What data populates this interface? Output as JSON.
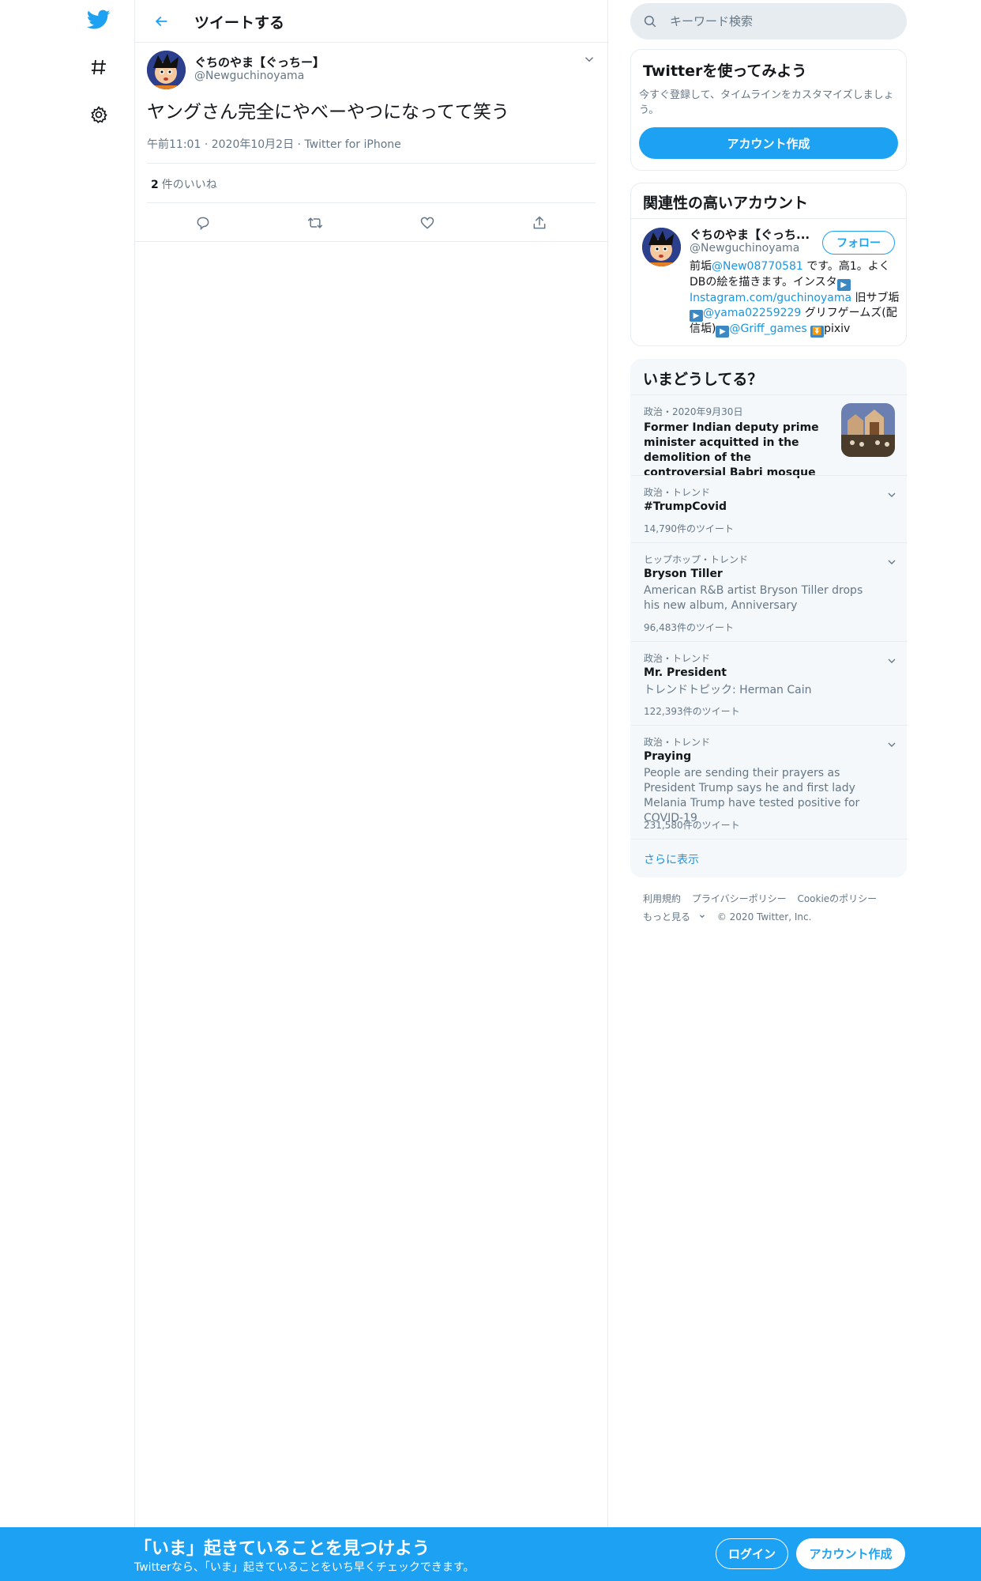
{
  "nav": {
    "logo_icon": "twitter-bird-icon",
    "explore_icon": "hashtag-icon",
    "settings_icon": "gear-icon"
  },
  "header": {
    "back_icon": "arrow-left-icon",
    "title": "ツイートする"
  },
  "tweet": {
    "author_name": "ぐちのやま【ぐっちー】",
    "author_handle": "@Newguchinoyama",
    "text": "ヤングさん完全にやべーやつになってて笑う",
    "time": "午前11:01",
    "date": "2020年10月2日",
    "source": "Twitter for iPhone",
    "likes_count": "2",
    "likes_label": "件のいいね"
  },
  "search": {
    "placeholder": "キーワード検索"
  },
  "signup_card": {
    "title": "Twitterを使ってみよう",
    "subtitle": "今すぐ登録して、タイムラインをカスタマイズしましょう。",
    "button": "アカウント作成"
  },
  "related": {
    "title": "関連性の高いアカウント",
    "name": "ぐちのやま【ぐっち...",
    "handle": "@Newguchinoyama",
    "follow": "フォロー",
    "bio_1": "前垢",
    "bio_link_1": "@New08770581",
    "bio_2": " です。高1。よくDBの絵を描きます。インスタ",
    "bio_link_2": "Instagram.com/guchinoyama",
    "bio_3": " 旧サブ垢",
    "bio_link_3": "@yama02259229",
    "bio_4": " グリフゲームズ(配信垢)",
    "bio_link_4": "@Griff_games",
    "bio_5": "pixiv"
  },
  "trends": {
    "title": "いまどうしてる？",
    "news": {
      "meta": "政治・2020年9月30日",
      "title": "Former Indian deputy prime minister acquitted in the demolition of the controversial Babri mosque"
    },
    "items": [
      {
        "meta": "政治・トレンド",
        "name": "#TrumpCovid",
        "desc": "",
        "count": "14,790件のツイート"
      },
      {
        "meta": "ヒップホップ・トレンド",
        "name": "Bryson Tiller",
        "desc": "American R&B artist Bryson Tiller drops his new album, Anniversary",
        "count": "96,483件のツイート"
      },
      {
        "meta": "政治・トレンド",
        "name": "Mr. President",
        "desc": "トレンドトピック: Herman Cain",
        "count": "122,393件のツイート"
      },
      {
        "meta": "政治・トレンド",
        "name": "Praying",
        "desc": "People are sending their prayers as President Trump says he and first lady Melania Trump have tested positive for COVID-19",
        "count": "231,580件のツイート"
      }
    ],
    "show_more": "さらに表示"
  },
  "footer": {
    "terms": "利用規約",
    "privacy": "プライバシーポリシー",
    "cookie": "Cookieのポリシー",
    "more": "もっと見る",
    "copyright": "© 2020 Twitter, Inc."
  },
  "bottombar": {
    "title": "「いま」起きていることを見つけよう",
    "subtitle": "Twitterなら、「いま」起きていることをいち早くチェックできます。",
    "login": "ログイン",
    "signup": "アカウント作成"
  },
  "colors": {
    "accent": "#1da1f2",
    "link": "#1b95e0",
    "muted": "#657786",
    "border": "#e6ecf0"
  }
}
